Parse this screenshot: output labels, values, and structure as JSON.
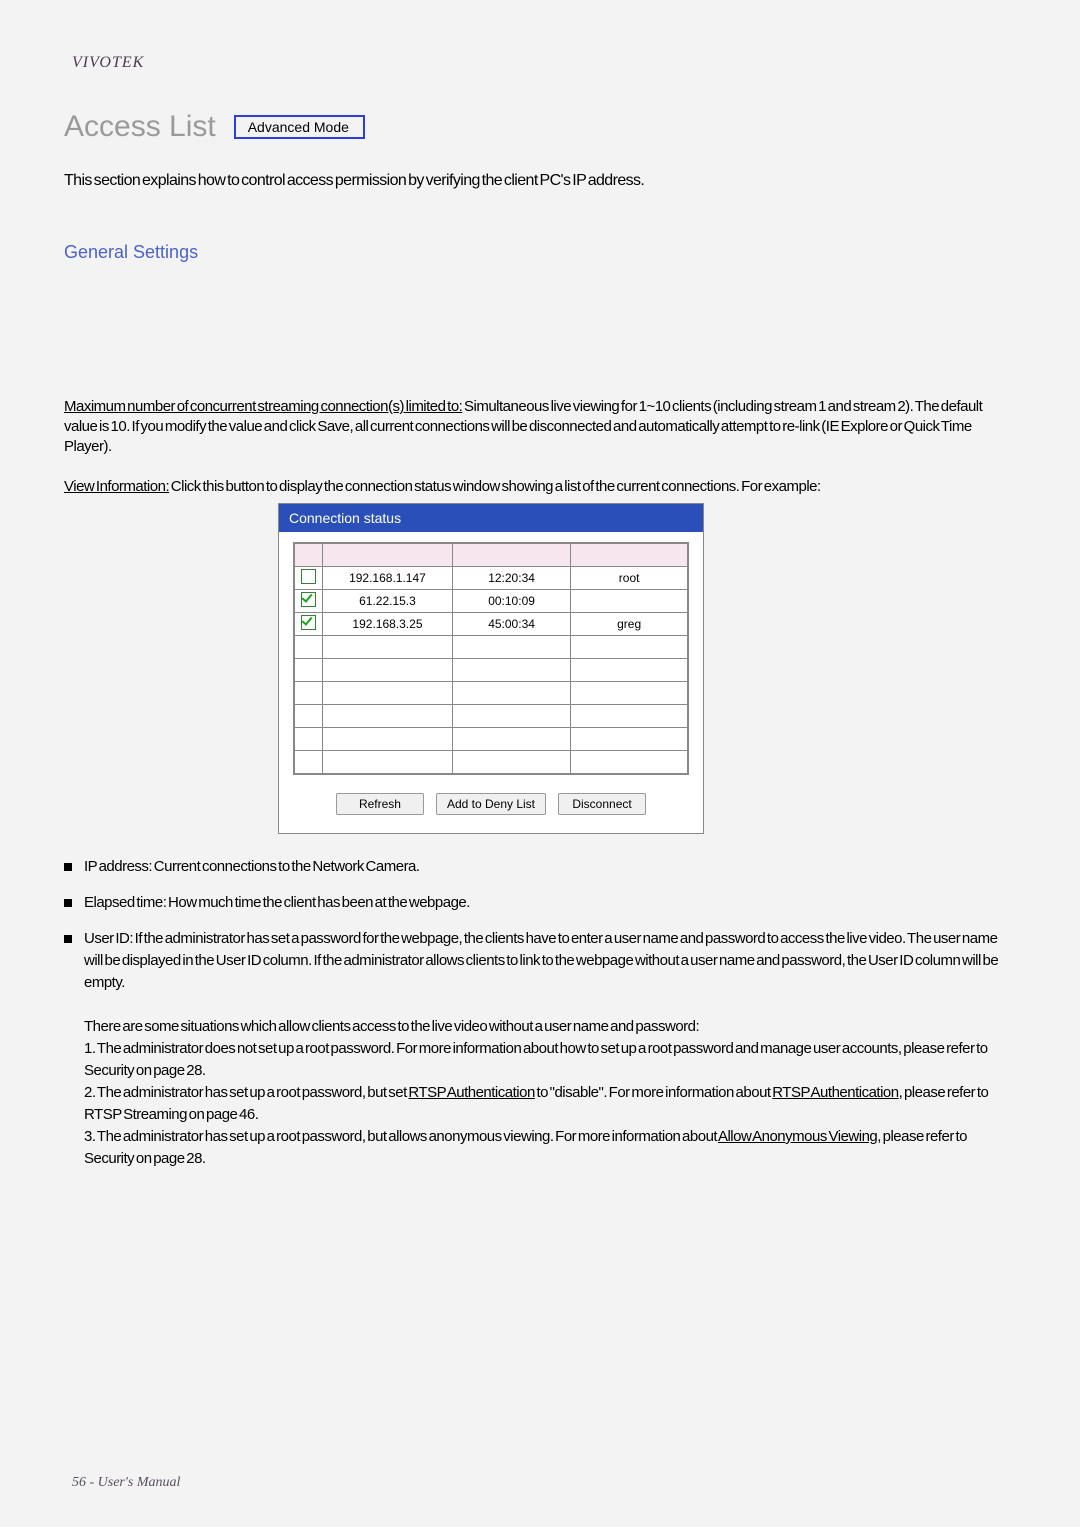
{
  "brand": "VIVOTEK",
  "title": "Access List",
  "mode_badge": "Advanced Mode",
  "intro": "This section explains how to control access permission by verifying the client PC's IP address.",
  "general_settings_h": "General Settings",
  "para1_u": "Maximum number of concurrent streaming connection(s) limited to:",
  "para1_rest": " Simultaneous live viewing for 1~10 clients (including stream 1 and stream 2). The default value is 10. If you modify the value and click Save, all current connections will be disconnected and automatically attempt to re-link (IE Explore or Quick Time Player).",
  "para2_u": "View Information:",
  "para2_rest": " Click this button to display the connection status window showing a list of the current connections. For example:",
  "panel": {
    "title": "Connection status",
    "rows": [
      {
        "checked": false,
        "ip": "192.168.1.147",
        "elapsed": "12:20:34",
        "user": "root"
      },
      {
        "checked": true,
        "ip": "61.22.15.3",
        "elapsed": "00:10:09",
        "user": ""
      },
      {
        "checked": true,
        "ip": "192.168.3.25",
        "elapsed": "45:00:34",
        "user": "greg"
      }
    ],
    "buttons": {
      "refresh": "Refresh",
      "add_deny": "Add to Deny List",
      "disconnect": "Disconnect"
    }
  },
  "bullets": {
    "ip": "IP address: Current connections to the Network Camera.",
    "elapsed": "Elapsed time: How much time the client has been at the webpage.",
    "uid_line1": "User ID: If the administrator has set a password for the webpage, the clients have to enter a user name and password to access the live video. The user name will be displayed in the User ID column. If the administrator allows clients to link to the webpage without a user name and password, the User ID column will be empty.",
    "uid_intro2": "There are some situations which allow clients access to the live video without a user name and password:",
    "uid_sub1_a": "1. The administrator does not set up a root password. For more information about how to set up a root password and manage user accounts, please refer to Security on page 28.",
    "uid_sub2_a": "2. The administrator has set up a root password, but set ",
    "uid_sub2_b": "RTSP Authentication",
    "uid_sub2_c": " to \"disable\". For more information about ",
    "uid_sub2_d": "RTSP Authentication",
    "uid_sub2_e": ", please refer to RTSP Streaming on page 46.",
    "uid_sub3_a": "3. The administrator has set up a root password, but allows anonymous viewing. For more information about ",
    "uid_sub3_b": "Allow Anonymous Viewing",
    "uid_sub3_c": ", please refer to Security on page 28."
  },
  "footer": "56 - User's Manual"
}
